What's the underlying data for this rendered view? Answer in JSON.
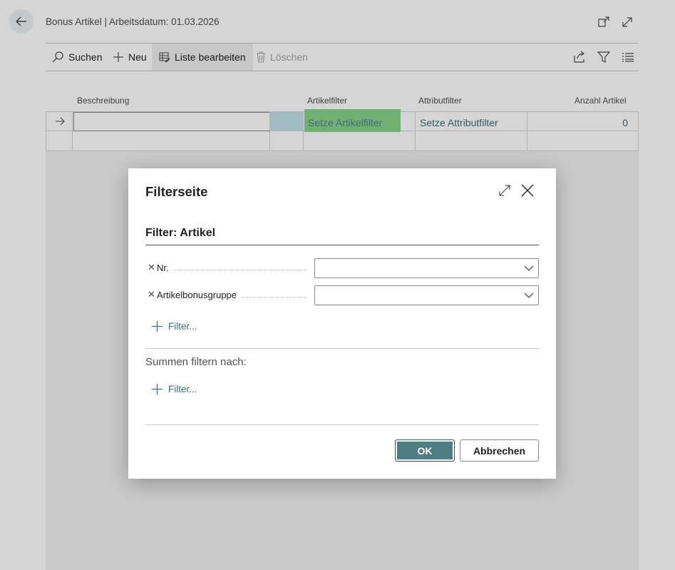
{
  "page": {
    "title": "Bonus Artikel | Arbeitsdatum: 01.03.2026"
  },
  "action_bar": {
    "search_label": "Suchen",
    "new_label": "Neu",
    "edit_list_label": "Liste bearbeiten",
    "delete_label": "Löschen"
  },
  "columns": {
    "description": "Beschreibung",
    "item_filter": "Artikelfilter",
    "attribute_filter": "Attributfilter",
    "item_count": "Anzahl Artikel"
  },
  "rows": [
    {
      "description": "",
      "item_filter": "Setze Artikelfilter",
      "attribute_filter": "Setze Attributfilter",
      "item_count": "0"
    }
  ],
  "dialog": {
    "title": "Filterseite",
    "section_title": "Filter: Artikel",
    "filters": [
      {
        "label": "Nr.",
        "value": ""
      },
      {
        "label": "Artikelbonusgruppe",
        "value": ""
      }
    ],
    "add_filter_label": "Filter...",
    "totals_label": "Summen filtern nach:",
    "add_totals_filter_label": "Filter...",
    "ok_label": "OK",
    "cancel_label": "Abbrechen"
  },
  "colors": {
    "accent": "#4e7e84",
    "link": "#3c6f77",
    "highlight": "#86d38a"
  }
}
